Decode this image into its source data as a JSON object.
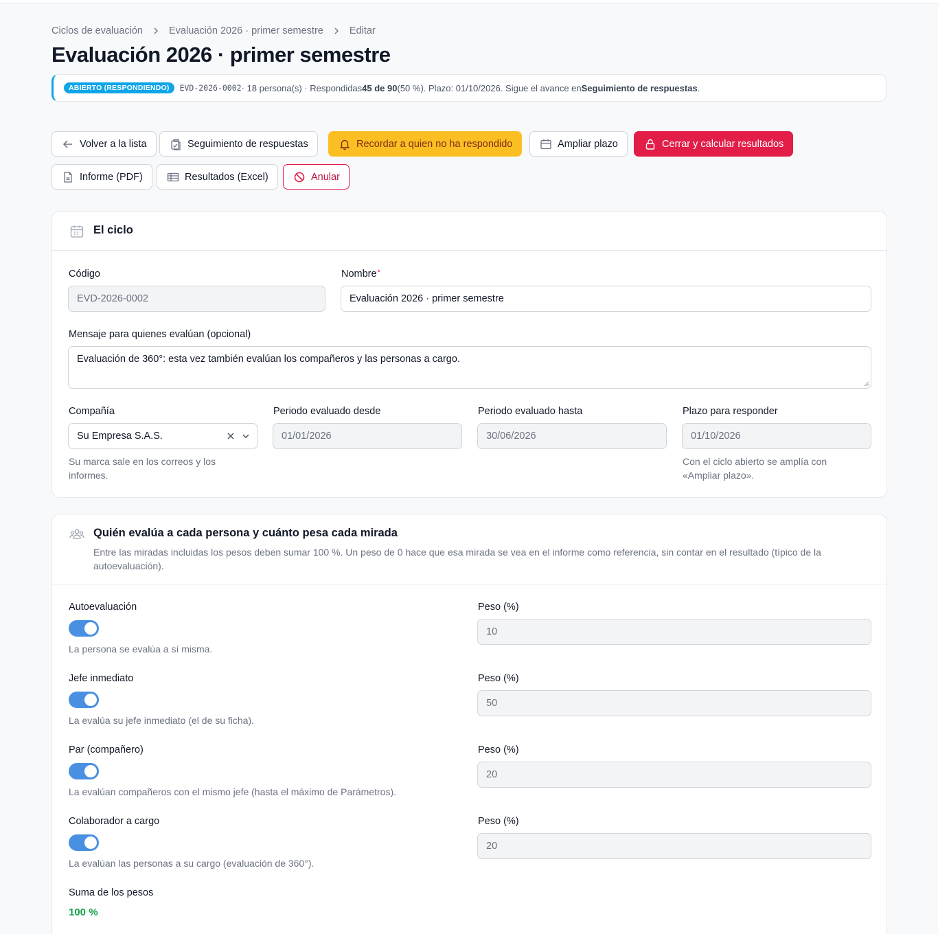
{
  "breadcrumb": {
    "items": [
      "Ciclos de evaluación",
      "Evaluación 2026 · primer semestre",
      "Editar"
    ]
  },
  "page_title": "Evaluación 2026 · primer semestre",
  "banner": {
    "badge": "ABIERTO (RESPONDIENDO)",
    "code": "EVD-2026-0002",
    "text_a": " · 18 persona(s) · Respondidas ",
    "answered": "45 de 90",
    "text_b": " (50 %). Plazo: 01/10/2026. Sigue el avance en ",
    "link": "Seguimiento de respuestas",
    "text_c": "."
  },
  "actions": {
    "back": "Volver a la lista",
    "tracking": "Seguimiento de respuestas",
    "remind": "Recordar a quien no ha respondido",
    "extend": "Ampliar plazo",
    "close": "Cerrar y calcular resultados",
    "pdf": "Informe (PDF)",
    "excel": "Resultados (Excel)",
    "cancel": "Anular"
  },
  "cycle": {
    "title": "El ciclo",
    "code_label": "Código",
    "code_value": "EVD-2026-0002",
    "name_label": "Nombre",
    "name_required": "*",
    "name_value": "Evaluación 2026 · primer semestre",
    "message_label": "Mensaje para quienes evalúan (opcional)",
    "message_value": "Evaluación de 360°: esta vez también evalúan los compañeros y las personas a cargo.",
    "company_label": "Compañía",
    "company_value": "Su Empresa S.A.S.",
    "company_help": "Su marca sale en los correos y los informes.",
    "from_label": "Periodo evaluado desde",
    "from_value": "01/01/2026",
    "to_label": "Periodo evaluado hasta",
    "to_value": "30/06/2026",
    "deadline_label": "Plazo para responder",
    "deadline_value": "01/10/2026",
    "deadline_help": "Con el ciclo abierto se amplía con «Ampliar plazo»."
  },
  "weights": {
    "title": "Quién evalúa a cada persona y cuánto pesa cada mirada",
    "subtitle": "Entre las miradas incluidas los pesos deben sumar 100 %. Un peso de 0 hace que esa mirada se vea en el informe como referencia, sin contar en el resultado (típico de la autoevaluación).",
    "rows": [
      {
        "label": "Autoevaluación",
        "enabled": true,
        "help": "La persona se evalúa a sí misma.",
        "weight_label": "Peso (%)",
        "weight": "10"
      },
      {
        "label": "Jefe inmediato",
        "enabled": true,
        "help": "La evalúa su jefe inmediato (el de su ficha).",
        "weight_label": "Peso (%)",
        "weight": "50"
      },
      {
        "label": "Par (compañero)",
        "enabled": true,
        "help": "La evalúan compañeros con el mismo jefe (hasta el máximo de Parámetros).",
        "weight_label": "Peso (%)",
        "weight": "20"
      },
      {
        "label": "Colaborador a cargo",
        "enabled": true,
        "help": "La evalúan las personas a su cargo (evaluación de 360°).",
        "weight_label": "Peso (%)",
        "weight": "20"
      }
    ],
    "sum_label": "Suma de los pesos",
    "sum_value": "100 %"
  },
  "colors": {
    "accent": "#4a90e2",
    "info": "#0ea5e9",
    "warning": "#fbbf24",
    "danger": "#e11d48",
    "success": "#16a34a"
  }
}
